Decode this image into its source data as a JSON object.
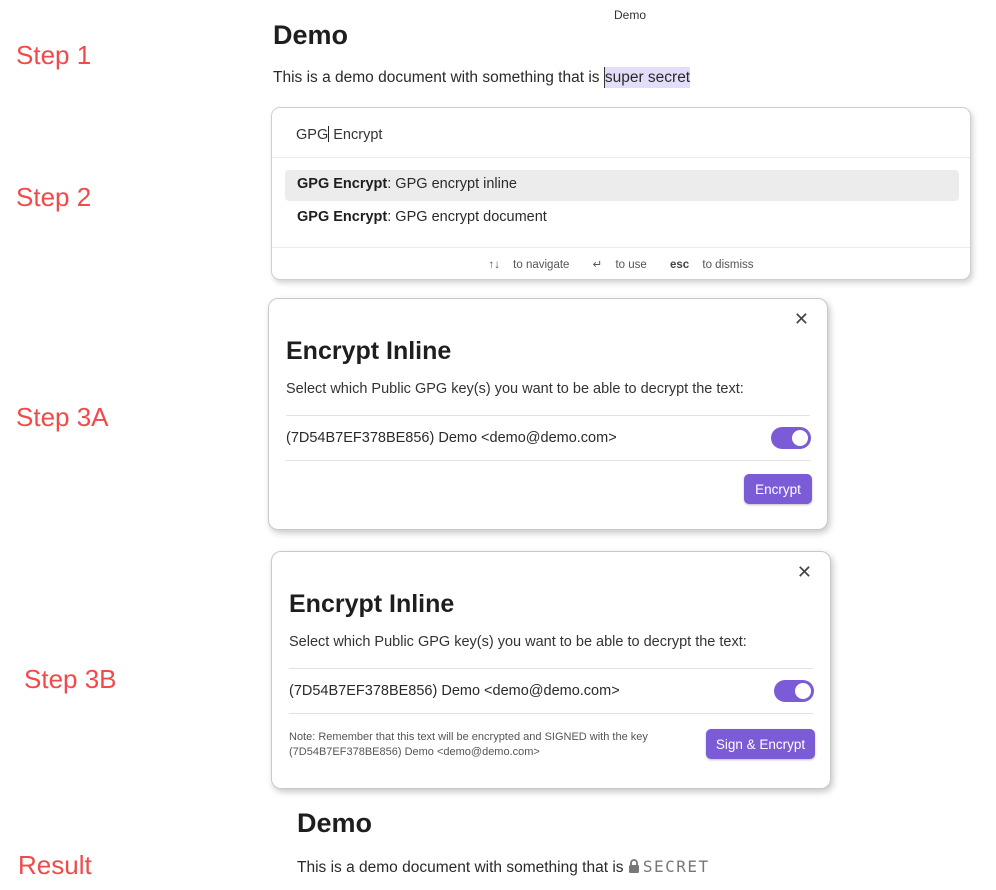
{
  "tab_title": "Demo",
  "labels": {
    "step1": "Step 1",
    "step2": "Step 2",
    "step3a": "Step 3A",
    "step3b": "Step 3B",
    "result": "Result"
  },
  "step1": {
    "heading": "Demo",
    "text_before": "This is a demo document with something that is ",
    "selected_text": "super secret"
  },
  "palette": {
    "input_before_caret": "GPG",
    "input_after_caret": " Encrypt",
    "suggestions": [
      {
        "prefix": "GPG Encrypt",
        "text": ": GPG encrypt inline"
      },
      {
        "prefix": "GPG Encrypt",
        "text": ": GPG encrypt document"
      }
    ],
    "hints": {
      "navigate_keys": "↑↓",
      "navigate": " to navigate",
      "use_key": "↵",
      "use": " to use",
      "dismiss_key": "esc",
      "dismiss": " to dismiss"
    }
  },
  "modal_a": {
    "close": "✕",
    "title": "Encrypt Inline",
    "description": "Select which Public GPG key(s) you want to be able to decrypt the text:",
    "key": "(7D54B7EF378BE856) Demo <demo@demo.com>",
    "toggle_on": true,
    "button": "Encrypt"
  },
  "modal_b": {
    "close": "✕",
    "title": "Encrypt Inline",
    "description": "Select which Public GPG key(s) you want to be able to decrypt the text:",
    "key": "(7D54B7EF378BE856) Demo <demo@demo.com>",
    "toggle_on": true,
    "note_line1": "Note: Remember that this text will be encrypted and SIGNED with the key",
    "note_line2": "(7D54B7EF378BE856) Demo <demo@demo.com>",
    "button": "Sign & Encrypt"
  },
  "result": {
    "heading": "Demo",
    "text_before": "This is a demo document with something that is ",
    "secret_icon": "lock-icon",
    "secret_label": "SECRET"
  },
  "colors": {
    "accent": "#7b5cd6",
    "step_label": "#f04a4a",
    "selection": "#e4dcfb"
  }
}
